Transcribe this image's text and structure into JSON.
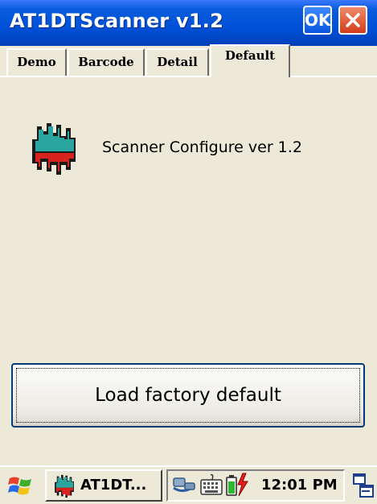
{
  "window": {
    "title": "AT1DTScanner v1.2",
    "ok_label": "OK"
  },
  "tabs": [
    {
      "label": "Demo"
    },
    {
      "label": "Barcode"
    },
    {
      "label": "Detail"
    },
    {
      "label": "Default",
      "active": true
    }
  ],
  "content": {
    "app_caption": "Scanner Configure ver 1.2",
    "app_icon": "scanner-waveform-icon",
    "load_default_label": "Load factory default"
  },
  "taskbar": {
    "start_icon": "windows-flag-icon",
    "task_label": "AT1DT...",
    "tray_icons": [
      "network-connection-icon",
      "keyboard-icon",
      "battery-charging-icon"
    ],
    "clock": "12:01 PM",
    "sip_icon": "input-panel-icon"
  },
  "colors": {
    "titlebar": "#0a5ddc",
    "background": "#ece9d8",
    "button_border": "#003c74",
    "close_button": "#d43d1a"
  }
}
